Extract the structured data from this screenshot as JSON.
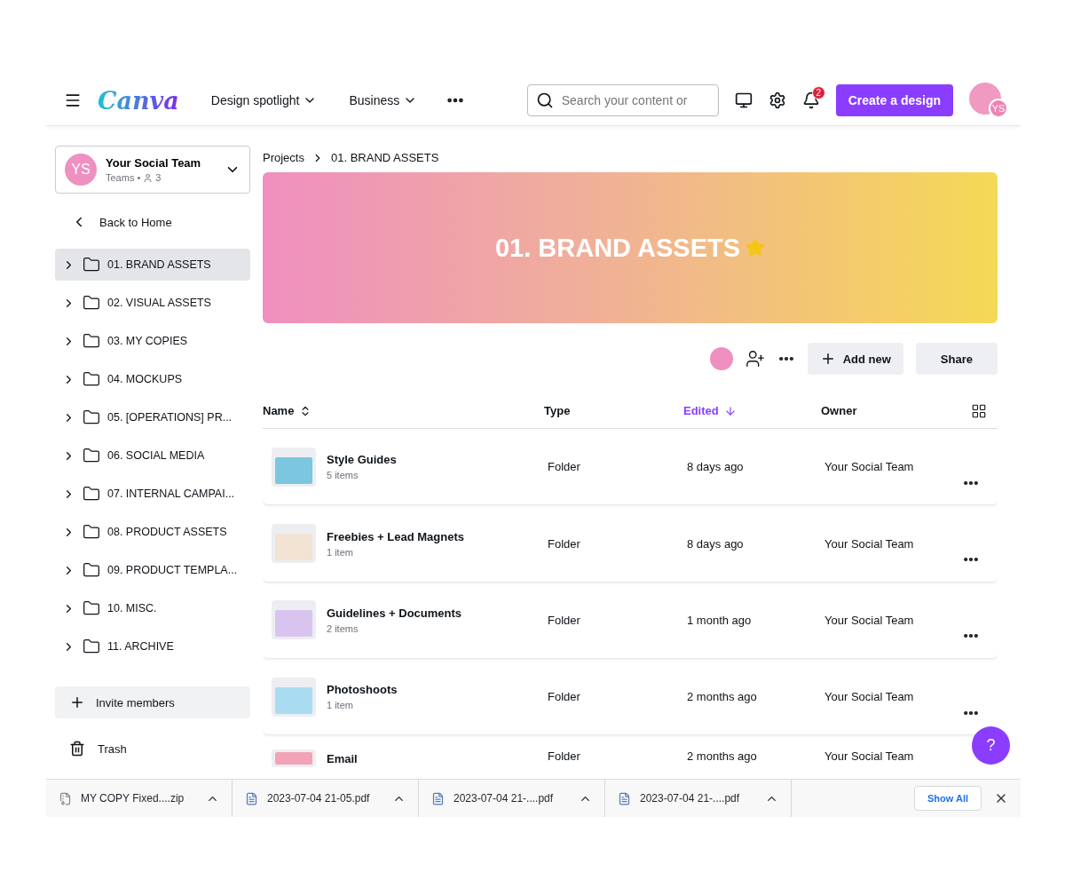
{
  "topbar": {
    "logo": "Canva",
    "nav": [
      {
        "label": "Design spotlight"
      },
      {
        "label": "Business"
      }
    ],
    "search": {
      "placeholder": "Search your content or"
    },
    "notifications": "2",
    "create": "Create a design",
    "avatar": "YS"
  },
  "team": {
    "initials": "YS",
    "name": "Your Social Team",
    "plan": "Teams •",
    "members": "3"
  },
  "back": "Back to Home",
  "folders": [
    {
      "label": "01. BRAND ASSETS",
      "selected": true
    },
    {
      "label": "02. VISUAL ASSETS",
      "selected": false
    },
    {
      "label": "03. MY COPIES",
      "selected": false
    },
    {
      "label": "04. MOCKUPS",
      "selected": false
    },
    {
      "label": "05. [OPERATIONS] PR...",
      "selected": false
    },
    {
      "label": "06. SOCIAL MEDIA",
      "selected": false
    },
    {
      "label": "07. INTERNAL CAMPAI...",
      "selected": false
    },
    {
      "label": "08. PRODUCT ASSETS",
      "selected": false
    },
    {
      "label": "09. PRODUCT TEMPLA...",
      "selected": false
    },
    {
      "label": "10. MISC.",
      "selected": false
    },
    {
      "label": "11. ARCHIVE",
      "selected": false
    }
  ],
  "invite": "Invite members",
  "trash": "Trash",
  "breadcrumb": [
    "Projects",
    "01. BRAND ASSETS"
  ],
  "banner": {
    "title": "01. BRAND ASSETS",
    "starred": true
  },
  "actions": {
    "add": "Add new",
    "share": "Share"
  },
  "table": {
    "columns": [
      {
        "label": "Name",
        "selected": false
      },
      {
        "label": "Type",
        "selected": false
      },
      {
        "label": "Edited",
        "selected": true
      },
      {
        "label": "Owner",
        "selected": false
      }
    ],
    "rows": [
      {
        "name": "Style Guides",
        "count": "5 items",
        "type": "Folder",
        "edited": "8 days ago",
        "owner": "Your Social Team",
        "color": "#7cc6e0"
      },
      {
        "name": "Freebies + Lead Magnets",
        "count": "1 item",
        "type": "Folder",
        "edited": "8 days ago",
        "owner": "Your Social Team",
        "color": "#f3e3d3"
      },
      {
        "name": "Guidelines + Documents",
        "count": "2 items",
        "type": "Folder",
        "edited": "1 month ago",
        "owner": "Your Social Team",
        "color": "#d9c4f0"
      },
      {
        "name": "Photoshoots",
        "count": "1 item",
        "type": "Folder",
        "edited": "2 months ago",
        "owner": "Your Social Team",
        "color": "#a9dcf0"
      },
      {
        "name": "Email",
        "type": "Folder",
        "edited": "2 months ago",
        "owner": "Your Social Team",
        "color": "#f2a3b8"
      }
    ]
  },
  "help": "?",
  "downloads": [
    {
      "name": "MY COPY Fixed....zip",
      "kind": "zip"
    },
    {
      "name": "2023-07-04 21-05.pdf",
      "kind": "pdf"
    },
    {
      "name": "2023-07-04 21-....pdf",
      "kind": "pdf"
    },
    {
      "name": "2023-07-04 21-....pdf",
      "kind": "pdf"
    }
  ],
  "show_all": "Show All"
}
